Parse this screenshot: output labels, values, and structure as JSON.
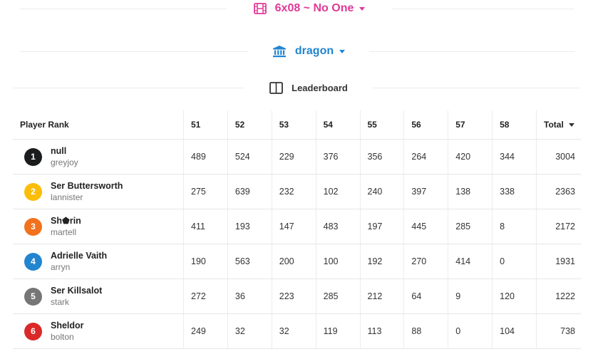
{
  "episode_selector": {
    "label": "6x08 ~ No One",
    "icon": "film-icon",
    "color": "#e03997"
  },
  "house_selector": {
    "label": "dragon",
    "icon": "bank-icon",
    "color": "#2185d0"
  },
  "board_selector": {
    "label": "Leaderboard",
    "icon": "columns-icon"
  },
  "table": {
    "headers": {
      "player": "Player Rank",
      "cols": [
        "51",
        "52",
        "53",
        "54",
        "55",
        "56",
        "57",
        "58"
      ],
      "total": "Total"
    },
    "rows": [
      {
        "rank": "1",
        "color": "#1b1c1d",
        "name": "null",
        "house": "greyjoy",
        "scores": [
          "489",
          "524",
          "229",
          "376",
          "356",
          "264",
          "420",
          "344"
        ],
        "total": "3004"
      },
      {
        "rank": "2",
        "color": "#fbbd08",
        "name": "Ser Buttersworth",
        "house": "lannister",
        "scores": [
          "275",
          "639",
          "232",
          "102",
          "240",
          "397",
          "138",
          "338"
        ],
        "total": "2363"
      },
      {
        "rank": "3",
        "color": "#f2711c",
        "name": "Sh⬟rin",
        "house": "martell",
        "scores": [
          "411",
          "193",
          "147",
          "483",
          "197",
          "445",
          "285",
          "8"
        ],
        "total": "2172"
      },
      {
        "rank": "4",
        "color": "#2185d0",
        "name": "Adrielle Vaith",
        "house": "arryn",
        "scores": [
          "190",
          "563",
          "200",
          "100",
          "192",
          "270",
          "414",
          "0"
        ],
        "total": "1931"
      },
      {
        "rank": "5",
        "color": "#767676",
        "name": "Ser Killsalot",
        "house": "stark",
        "scores": [
          "272",
          "36",
          "223",
          "285",
          "212",
          "64",
          "9",
          "120"
        ],
        "total": "1222"
      },
      {
        "rank": "6",
        "color": "#db2828",
        "name": "Sheldor",
        "house": "bolton",
        "scores": [
          "249",
          "32",
          "32",
          "119",
          "113",
          "88",
          "0",
          "104"
        ],
        "total": "738"
      }
    ]
  }
}
